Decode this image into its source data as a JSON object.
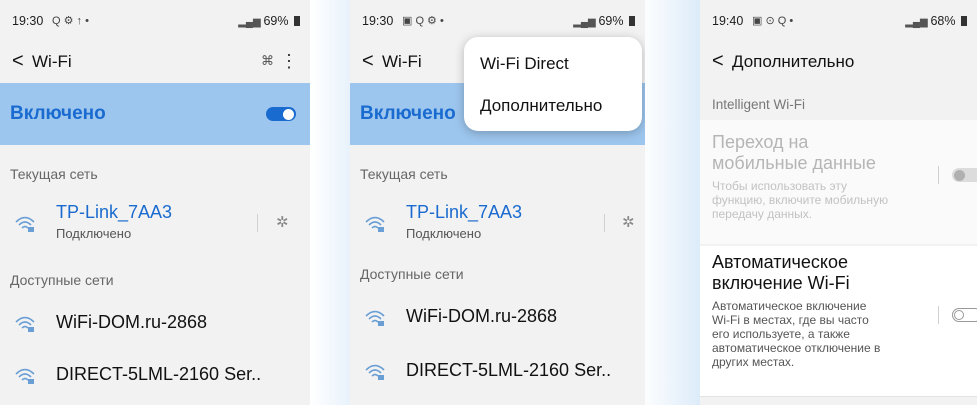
{
  "screen1": {
    "status": {
      "time": "19:30",
      "left_icons": "Q ⚙ ↑ •",
      "battery": "69%"
    },
    "header": {
      "back": "<",
      "title": "Wi-Fi",
      "more": "⋮"
    },
    "switch_label": "Включено",
    "switch_on": true,
    "current_section": "Текущая сеть",
    "current_network": {
      "name": "TP-Link_7AA3",
      "status": "Подключено"
    },
    "available_section": "Доступные сети",
    "networks": [
      "WiFi-DOM.ru-2868",
      "DIRECT-5LML-2160 Ser.."
    ]
  },
  "screen2": {
    "status": {
      "time": "19:30",
      "left_icons": "▣ Q ⚙ •",
      "battery": "69%"
    },
    "header": {
      "back": "<",
      "title": "Wi-Fi"
    },
    "switch_label": "Включено",
    "menu": [
      "Wi-Fi Direct",
      "Дополнительно"
    ],
    "current_section": "Текущая сеть",
    "current_network": {
      "name": "TP-Link_7AA3",
      "status": "Подключено"
    },
    "available_section": "Доступные сети",
    "networks": [
      "WiFi-DOM.ru-2868",
      "DIRECT-5LML-2160 Ser.."
    ]
  },
  "screen3": {
    "status": {
      "time": "19:40",
      "left_icons": "▣ ⊙ Q •",
      "battery": "68%"
    },
    "header": {
      "back": "<",
      "title": "Дополнительно"
    },
    "section": "Intelligent Wi-Fi",
    "mobile_switch": {
      "title_line1": "Переход на",
      "title_line2": "мобильные данные",
      "desc": [
        "Чтобы использовать эту",
        "функцию, включите мобильную",
        "передачу данных."
      ],
      "enabled": false
    },
    "auto_wifi": {
      "title_line1": "Автоматическое",
      "title_line2": "включение Wi-Fi",
      "desc": [
        "Автоматическое включение",
        "Wi-Fi в местах, где вы часто",
        "его используете, а также",
        "автоматическое отключение в",
        "других местах."
      ],
      "on": false
    }
  },
  "colors": {
    "accent": "#1a6bd0",
    "switch_bar": "#9dc6ee",
    "background": "#f2f2f2"
  }
}
